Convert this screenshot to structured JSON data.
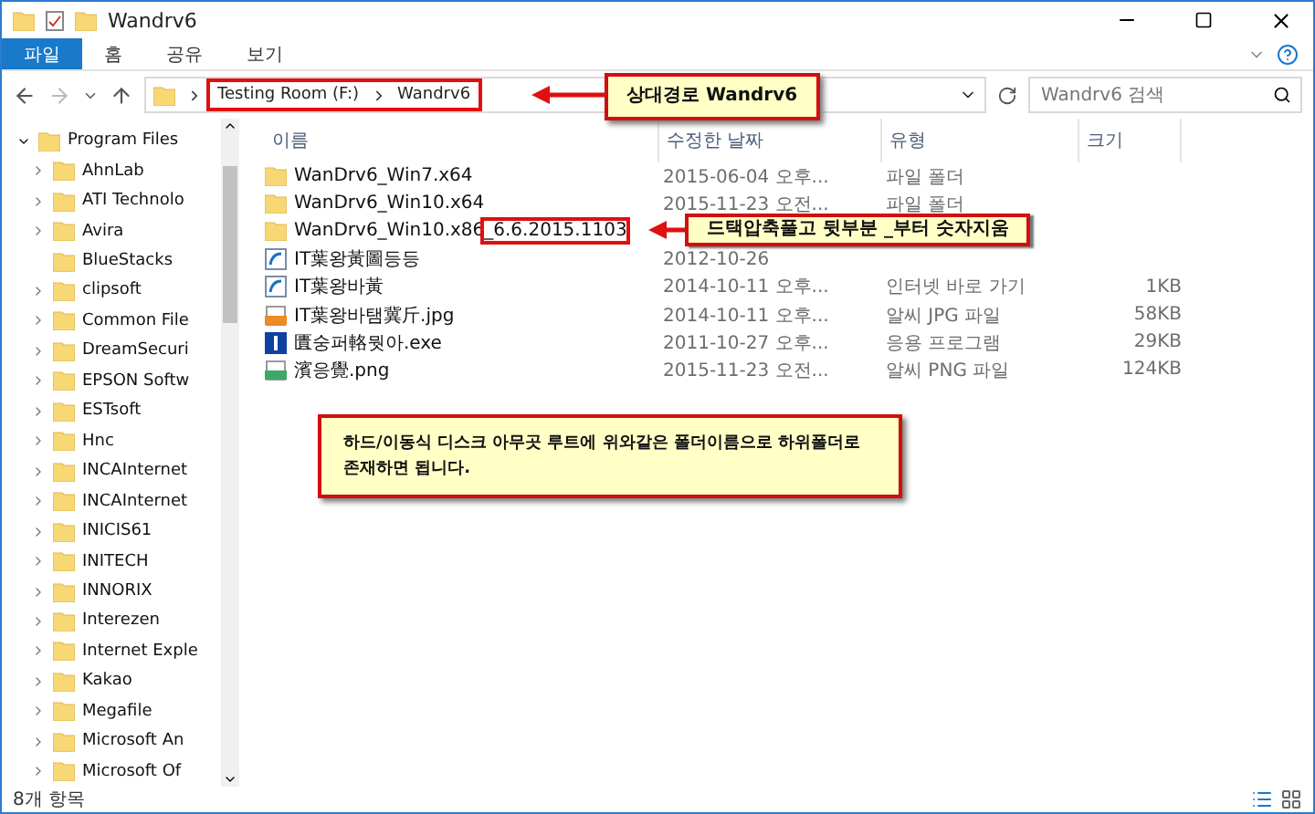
{
  "window": {
    "title": "Wandrv6"
  },
  "ribbon_tabs": [
    {
      "label": "파일",
      "selected": true
    },
    {
      "label": "홈",
      "selected": false
    },
    {
      "label": "공유",
      "selected": false
    },
    {
      "label": "보기",
      "selected": false
    }
  ],
  "address": {
    "segments": [
      "Testing Room (F:)",
      "Wandrv6"
    ]
  },
  "search": {
    "placeholder": "Wandrv6 검색"
  },
  "sidebar": {
    "items": [
      {
        "label": "Program Files",
        "expanded": true,
        "children": [
          {
            "label": "AhnLab",
            "expandable": true
          },
          {
            "label": "ATI Technolo",
            "expandable": true
          },
          {
            "label": "Avira",
            "expandable": true
          },
          {
            "label": "BlueStacks",
            "expandable": false
          },
          {
            "label": "clipsoft",
            "expandable": true
          },
          {
            "label": "Common File",
            "expandable": true
          },
          {
            "label": "DreamSecuri",
            "expandable": true
          },
          {
            "label": "EPSON Softw",
            "expandable": true
          },
          {
            "label": "ESTsoft",
            "expandable": true
          },
          {
            "label": "Hnc",
            "expandable": true
          },
          {
            "label": "INCAInternet",
            "expandable": true
          },
          {
            "label": "INCAInternet",
            "expandable": true
          },
          {
            "label": "INICIS61",
            "expandable": true
          },
          {
            "label": "INITECH",
            "expandable": true
          },
          {
            "label": "INNORIX",
            "expandable": true
          },
          {
            "label": "Interezen",
            "expandable": true
          },
          {
            "label": "Internet Exple",
            "expandable": true
          },
          {
            "label": "Kakao",
            "expandable": true
          },
          {
            "label": "Megafile",
            "expandable": true
          },
          {
            "label": "Microsoft An",
            "expandable": true
          },
          {
            "label": "Microsoft Of",
            "expandable": true
          }
        ]
      }
    ]
  },
  "table": {
    "columns": [
      "이름",
      "수정한 날짜",
      "유형",
      "크기"
    ],
    "rows": [
      {
        "kind": "folder",
        "name": "WanDrv6_Win7.x64",
        "date": "2015-06-04 오후...",
        "type": "파일 폴더"
      },
      {
        "kind": "folder",
        "name": "WanDrv6_Win10.x64",
        "date": "2015-11-23 오전...",
        "type": "파일 폴더"
      },
      {
        "kind": "folder",
        "name": "WanDrv6_Win10.x86",
        "name_highlight": "_6.6.2015.1103"
      },
      {
        "kind": "shortcut",
        "name": "IT葉왕黃圖등등",
        "date": "2012-10-26"
      },
      {
        "kind": "shortcut",
        "name": "IT葉왕바黃",
        "date": "2014-10-11 오후...",
        "type": "인터넷 바로 가기",
        "size": "1KB"
      },
      {
        "kind": "jpg",
        "name": "IT葉왕바탬冀斤.jpg",
        "date": "2014-10-11 오후...",
        "type": "알씨 JPG 파일",
        "size": "58KB"
      },
      {
        "kind": "exe",
        "name": "匱숭퍼輅뭣아.exe",
        "date": "2011-10-27 오후...",
        "type": "응용 프로그램",
        "size": "29KB"
      },
      {
        "kind": "png",
        "name": "濱응覺.png",
        "date": "2015-11-23 오전...",
        "type": "알씨 PNG 파일",
        "size": "124KB"
      }
    ]
  },
  "callouts": [
    {
      "kind": "path",
      "text": "상대경로 Wandrv6"
    },
    {
      "kind": "rename",
      "text": "드택압축풀고 뒷부분 _부터 숫자지움"
    },
    {
      "kind": "note",
      "text": "하드/이동식 디스크 아무곳 루트에 위와같은 폴더이름으로 하위폴더로 존재하면 됩니다."
    }
  ],
  "status_bar": {
    "count": "8개 항목"
  }
}
